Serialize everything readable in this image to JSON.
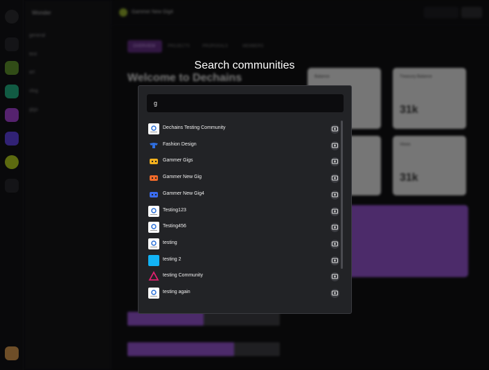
{
  "modal": {
    "title": "Search communities",
    "search_value": "g",
    "search_placeholder": ""
  },
  "communities": [
    {
      "name": "Dechains Testing Community",
      "icon": "dechains-logo-icon",
      "color": "#ffffff"
    },
    {
      "name": "Fashion Design",
      "icon": "fashion-logo-icon",
      "color": "#2f6fe0"
    },
    {
      "name": "Gammer Gigs",
      "icon": "gamepad-logo-icon",
      "color": "#f2b01e"
    },
    {
      "name": "Gammer New Gig",
      "icon": "gamepad-logo-icon",
      "color": "#f06a2a"
    },
    {
      "name": "Gammer New Gig4",
      "icon": "gamepad-logo-icon",
      "color": "#3b6df0"
    },
    {
      "name": "Testing123",
      "icon": "dechains-logo-icon",
      "color": "#ffffff"
    },
    {
      "name": "Testing456",
      "icon": "dechains-logo-icon",
      "color": "#ffffff"
    },
    {
      "name": "testing",
      "icon": "dechains-logo-icon",
      "color": "#ffffff"
    },
    {
      "name": "testing 2",
      "icon": "square-avatar-icon",
      "color": "#12b3f5"
    },
    {
      "name": "testing Community",
      "icon": "triangle-logo-icon",
      "color": "#e0206e"
    },
    {
      "name": "testing again",
      "icon": "dechains-logo-icon",
      "color": "#ffffff"
    }
  ],
  "background": {
    "sidebar_title": "Wonder",
    "sidebar_items": [
      "general",
      "test",
      "art",
      "vlog",
      "gigs"
    ],
    "header_title": "Gammer New Gig4",
    "tabs": [
      "OVERVIEW",
      "PROJECTS",
      "PROPOSALS",
      "MEMBERS"
    ],
    "welcome": "Welcome to Dechains",
    "cards": [
      {
        "label": "Balance",
        "value": ""
      },
      {
        "label": "Treasury Balance",
        "value": "31k"
      },
      {
        "label": "",
        "value": ""
      },
      {
        "label": "Views",
        "value": "31k"
      }
    ]
  }
}
